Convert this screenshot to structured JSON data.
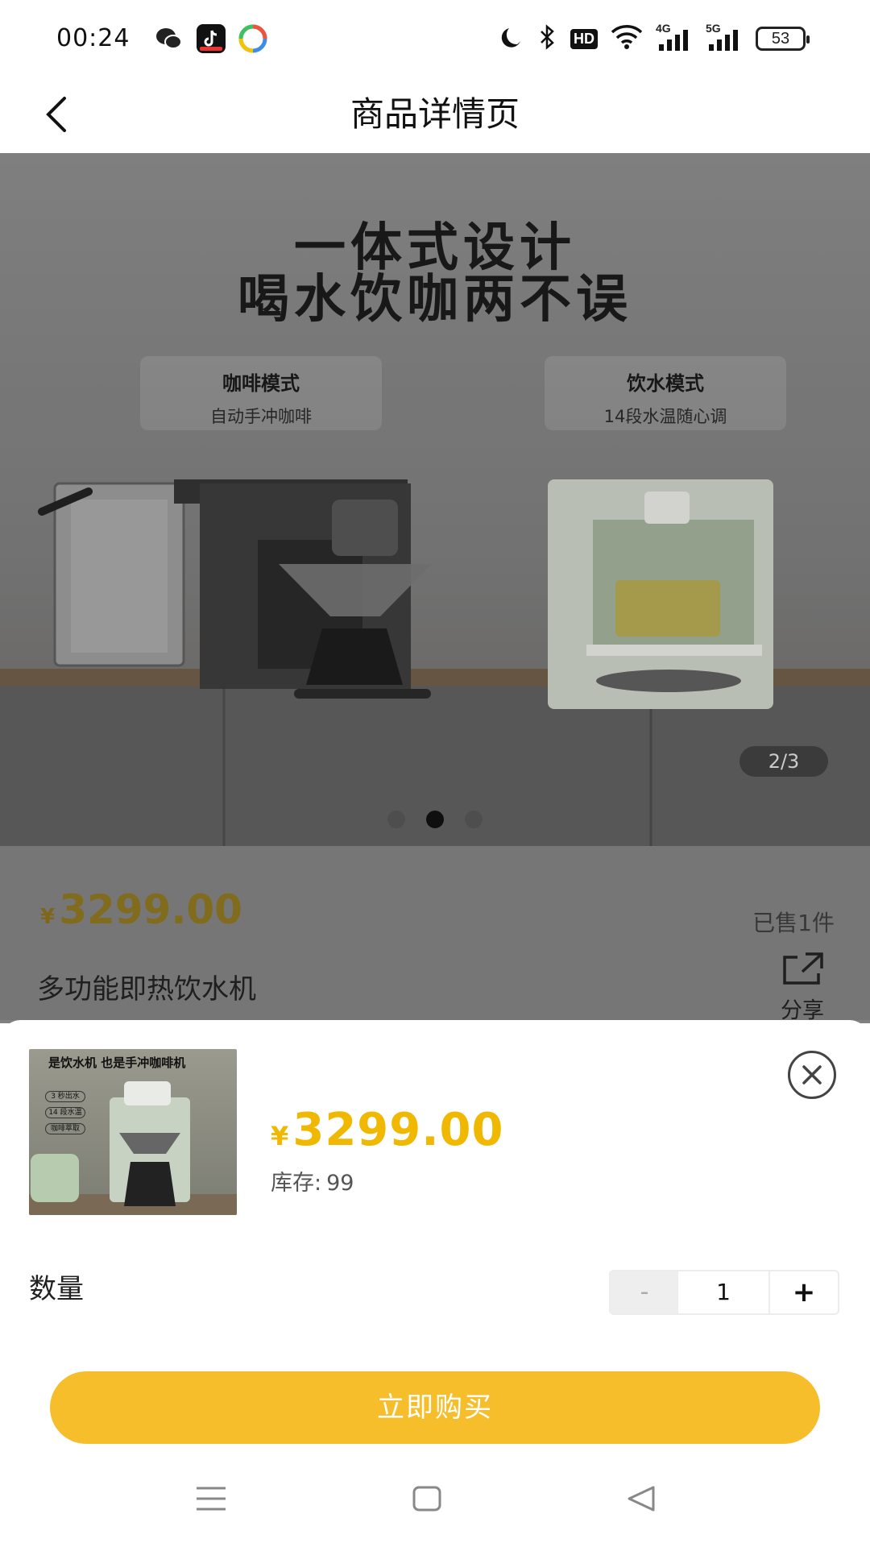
{
  "status_bar": {
    "time": "00:24",
    "battery": "53",
    "icons": [
      "wechat-icon",
      "tiktok-icon",
      "browser-icon",
      "moon-icon",
      "bluetooth-icon",
      "hd-icon",
      "wifi-icon",
      "4g-signal-icon",
      "5g-signal-icon"
    ],
    "hd_label": "HD",
    "net_4g": "4G",
    "net_5g": "5G"
  },
  "nav": {
    "title": "商品详情页",
    "back_icon": "chevron-left-icon"
  },
  "hero": {
    "headline_line1": "一体式设计",
    "headline_line2": "喝水饮咖两不误",
    "mode_left_title": "咖啡模式",
    "mode_left_sub": "自动手冲咖啡",
    "mode_right_title": "饮水模式",
    "mode_right_sub": "14段水温随心调",
    "counter": "2/3",
    "current_slide": 2,
    "total_slides": 3
  },
  "product": {
    "currency": "¥",
    "price": "3299.00",
    "sold": "已售1件",
    "name": "多功能即热饮水机",
    "share_label": "分享"
  },
  "sheet": {
    "thumb_title": "是饮水机 也是手冲咖啡机",
    "thumb_chips": [
      "3 秒出水",
      "14 段水温",
      "咖啡萃取"
    ],
    "currency": "¥",
    "price": "3299.00",
    "stock_label": "库存:",
    "stock_value": "99",
    "qty_label": "数量",
    "minus": "-",
    "qty": "1",
    "plus": "+",
    "buy_label": "立即购买"
  },
  "colors": {
    "accent": "#f6be2a",
    "price": "#f0b800"
  }
}
